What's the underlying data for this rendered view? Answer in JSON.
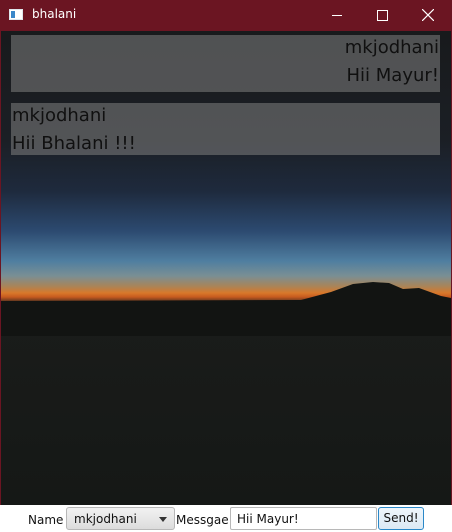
{
  "window": {
    "title": "bhalani",
    "icon": "app-window-icon",
    "controls": [
      "minimize-icon",
      "maximize-icon",
      "close-icon"
    ]
  },
  "messages": [
    {
      "side": "right",
      "sender": "mkjodhani",
      "text": "Hii Mayur!"
    },
    {
      "side": "left",
      "sender": "mkjodhani",
      "text": "Hii Bhalani !!!"
    }
  ],
  "input_bar": {
    "name_label": "Name :",
    "name_selected": "mkjodhani",
    "message_label": "Messgae :",
    "message_value": "Hii Mayur!",
    "send_label": "Send!"
  },
  "colors": {
    "titlebar": "#6b1522",
    "bubble": "rgba(128,128,128,0.55)",
    "send_border": "#2a88c8"
  }
}
